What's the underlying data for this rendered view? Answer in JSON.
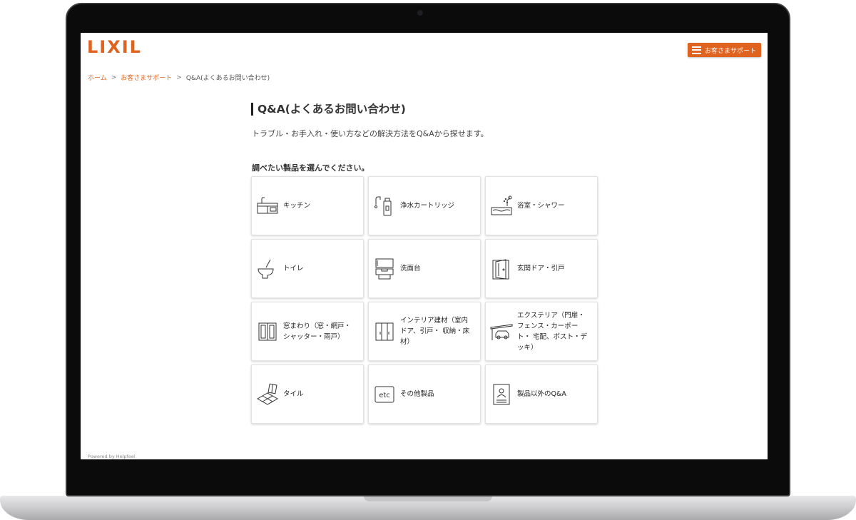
{
  "header": {
    "logo_text": "LIXIL",
    "support_button_label": "お客さまサポート",
    "brand_color": "#e0621f"
  },
  "breadcrumb": {
    "items": [
      "ホーム",
      "お客さまサポート",
      "Q&A(よくあるお問い合わせ)"
    ],
    "separator": ">"
  },
  "main": {
    "title": "Q&A(よくあるお問い合わせ)",
    "subtitle": "トラブル・お手入れ・使い方などの解決方法をQ&Aから探せます。",
    "section_label": "調べたい製品を選んでください。",
    "categories": [
      {
        "label": "キッチン",
        "icon": "kitchen-icon"
      },
      {
        "label": "浄水カートリッジ",
        "icon": "water-filter-icon"
      },
      {
        "label": "浴室・シャワー",
        "icon": "bathtub-shower-icon"
      },
      {
        "label": "トイレ",
        "icon": "toilet-icon"
      },
      {
        "label": "洗面台",
        "icon": "washbasin-icon"
      },
      {
        "label": "玄関ドア・引戸",
        "icon": "door-icon"
      },
      {
        "label": "窓まわり（窓・網戸・シャッター・雨戸）",
        "icon": "window-icon"
      },
      {
        "label": "インテリア建材（室内ドア、引戸・ 収納・床材）",
        "icon": "interior-icon"
      },
      {
        "label": "エクステリア（門扉・フェンス・カーポート・ 宅配、ポスト・デッキ）",
        "icon": "carport-icon"
      },
      {
        "label": "タイル",
        "icon": "tile-icon"
      },
      {
        "label": "その他製品",
        "icon": "etc-icon"
      },
      {
        "label": "製品以外のQ&A",
        "icon": "document-icon"
      }
    ],
    "etc_icon_text": "etc"
  },
  "footer": {
    "powered_by": "Powered by Helpfeel"
  }
}
